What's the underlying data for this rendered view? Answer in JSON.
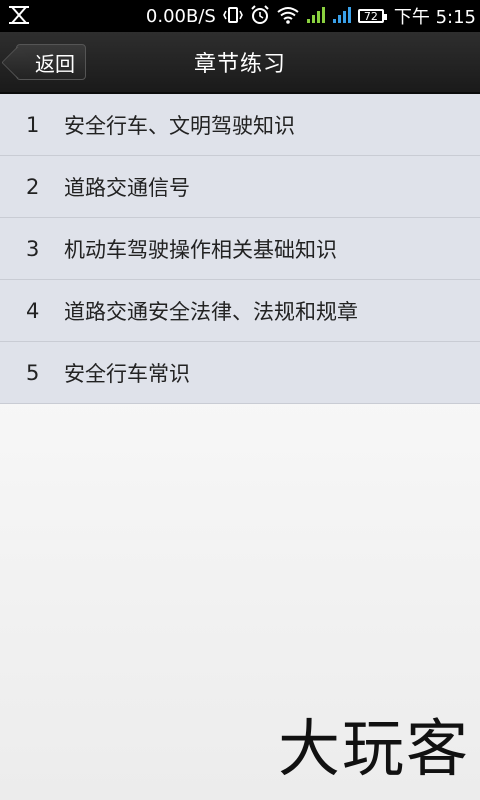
{
  "status_bar": {
    "speed": "0.00B/S",
    "battery": "72",
    "time": "下午 5:15"
  },
  "header": {
    "back_label": "返回",
    "title": "章节练习"
  },
  "chapters": [
    {
      "num": "1",
      "title": "安全行车、文明驾驶知识"
    },
    {
      "num": "2",
      "title": "道路交通信号"
    },
    {
      "num": "3",
      "title": "机动车驾驶操作相关基础知识"
    },
    {
      "num": "4",
      "title": "道路交通安全法律、法规和规章"
    },
    {
      "num": "5",
      "title": "安全行车常识"
    }
  ],
  "watermark": "大玩客"
}
